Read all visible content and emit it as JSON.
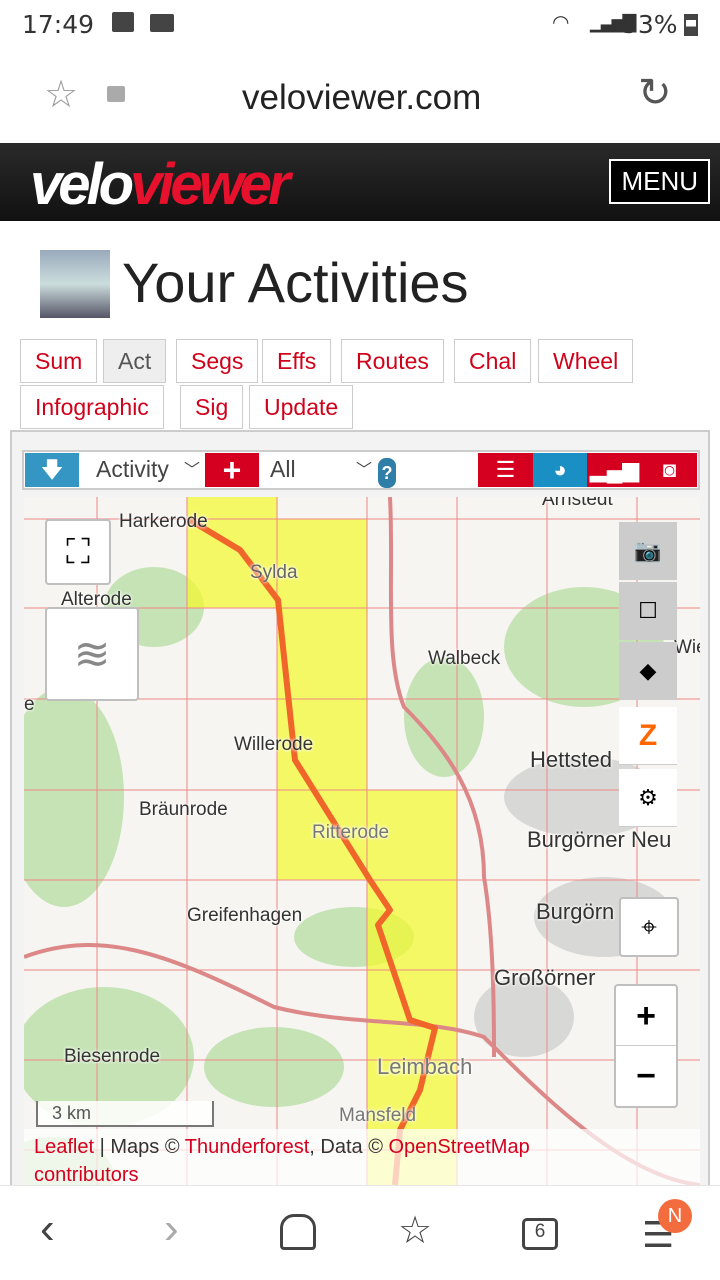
{
  "status": {
    "time": "17:49",
    "battery": "53%"
  },
  "browser": {
    "url": "veloviewer.com",
    "tab_count": "6",
    "profile_badge": "N"
  },
  "site": {
    "logo_velo": "velo",
    "logo_viewer": "viewer",
    "menu": "MENU"
  },
  "page": {
    "title": "Your Activities"
  },
  "tabs": [
    {
      "label": "Sum"
    },
    {
      "label": "Act"
    },
    {
      "label": "Segs"
    },
    {
      "label": "Effs"
    },
    {
      "label": "Routes"
    },
    {
      "label": "Chal"
    },
    {
      "label": "Wheel"
    },
    {
      "label": "Infographic"
    },
    {
      "label": "Sig"
    },
    {
      "label": "Update"
    }
  ],
  "toolbar": {
    "type_select": "Activity",
    "filter_select": "All",
    "help": "?"
  },
  "map": {
    "labels": [
      "Harkerode",
      "Sylda",
      "Alterode",
      "Walbeck",
      "Willerode",
      "Hettsted",
      "Bräunrode",
      "Ritterode",
      "Burgörner Neu",
      "Greifenhagen",
      "Burgörn  lto",
      "Großörner",
      "Biesenrode",
      "Leimbach",
      "Mansfeld",
      "Arnstedt",
      "Wie",
      "e"
    ],
    "scale": "3 km",
    "attribution": {
      "leaflet": "Leaflet",
      "sep": " | Maps © ",
      "thunderforest": "Thunderforest",
      "data": ", Data © ",
      "osm": "OpenStreetMap",
      "contributors": "contributors"
    },
    "zoom_in": "+",
    "zoom_out": "−",
    "colors": {
      "route": "#f0662a",
      "tiles": "#f4fa2a",
      "grid": "#e88"
    }
  }
}
